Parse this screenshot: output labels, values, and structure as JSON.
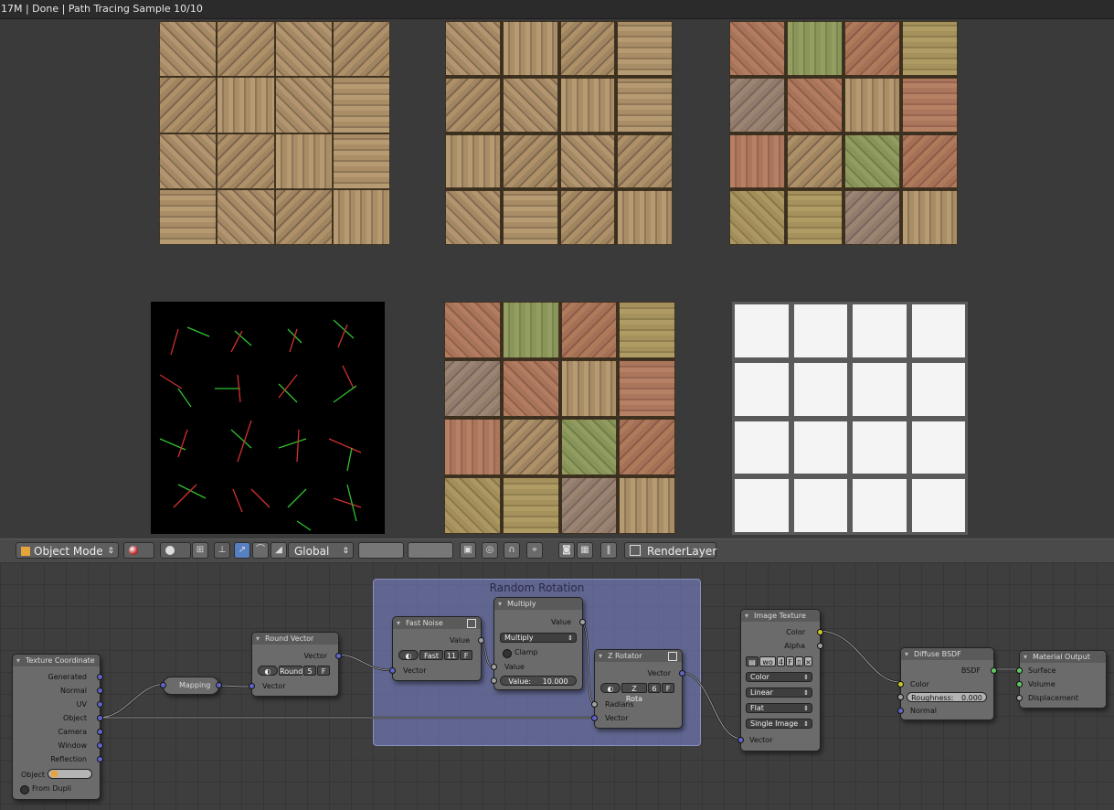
{
  "status": {
    "text": "17M | Done | Path Tracing Sample 10/10"
  },
  "toolbar": {
    "mode": "Object Mode",
    "transform_space": "Global",
    "render_layer": "RenderLayer"
  },
  "frame": {
    "title": "Random Rotation"
  },
  "nodes": {
    "texcoord": {
      "title": "Texture Coordinate",
      "outputs": [
        "Generated",
        "Normal",
        "UV",
        "Object",
        "Camera",
        "Window",
        "Reflection"
      ],
      "object_label": "Object",
      "from_dupli": "From Dupli"
    },
    "mapping": {
      "title": "Mapping"
    },
    "round": {
      "title": "Round Vector",
      "out": "Vector",
      "mode": "Round",
      "num": "5",
      "flag": "F",
      "in": "Vector"
    },
    "noise": {
      "title": "Fast Noise",
      "out": "Value",
      "mode": "Fast",
      "num": "11",
      "flag": "F",
      "in": "Vector"
    },
    "multiply": {
      "title": "Multiply",
      "out": "Value",
      "op": "Multiply",
      "clamp": "Clamp",
      "in1": "Value",
      "in2": "Value:",
      "in2_val": "10.000"
    },
    "zrot": {
      "title": "Z Rotator",
      "out": "Vector",
      "mode": "Z Rota",
      "num": "6",
      "flag": "F",
      "in1": "Radians",
      "in2": "Vector"
    },
    "imgtex": {
      "title": "Image Texture",
      "out1": "Color",
      "out2": "Alpha",
      "img": "wo",
      "users": "4",
      "flag": "F",
      "color": "Color",
      "interp": "Linear",
      "proj": "Flat",
      "source": "Single Image",
      "in": "Vector"
    },
    "diffuse": {
      "title": "Diffuse BSDF",
      "out": "BSDF",
      "in1": "Color",
      "rough_label": "Roughness:",
      "rough_val": "0.000",
      "in3": "Normal"
    },
    "output": {
      "title": "Material Output",
      "in1": "Surface",
      "in2": "Volume",
      "in3": "Displacement"
    }
  }
}
